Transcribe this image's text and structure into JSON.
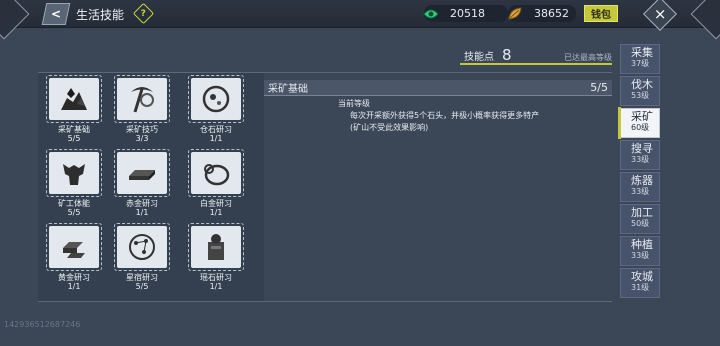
{
  "header": {
    "title": "生活技能",
    "back_label": "<",
    "help_label": "?",
    "currency_1": "20518",
    "currency_2": "38652",
    "wallet_label": "钱包",
    "close_label": "×"
  },
  "skill_points": {
    "label": "技能点",
    "value": "8",
    "max_text": "已达最高等级"
  },
  "skills": [
    {
      "name": "采矿基础",
      "level": "5/5",
      "icon": "ore-icon"
    },
    {
      "name": "采矿技巧",
      "level": "3/3",
      "icon": "pickaxe-icon"
    },
    {
      "name": "仓石研习",
      "level": "1/1",
      "icon": "stone-disc-icon"
    },
    {
      "name": "矿工体能",
      "level": "5/5",
      "icon": "muscle-icon"
    },
    {
      "name": "赤金研习",
      "level": "1/1",
      "icon": "ingot-bar-icon"
    },
    {
      "name": "白金研习",
      "level": "1/1",
      "icon": "ring-icon"
    },
    {
      "name": "黄金研习",
      "level": "1/1",
      "icon": "gold-bars-icon"
    },
    {
      "name": "星宿研习",
      "level": "5/5",
      "icon": "constellation-icon"
    },
    {
      "name": "瑶石研习",
      "level": "1/1",
      "icon": "jade-stone-icon"
    }
  ],
  "detail": {
    "title": "采矿基础",
    "level": "5/5",
    "current_level_label": "当前等级",
    "description": "每次开采额外获得5个石头，并极小概率获得更多特产(矿山不受此效果影响)"
  },
  "tabs": [
    {
      "label": "采集",
      "sub": "37级",
      "active": false
    },
    {
      "label": "伐木",
      "sub": "53级",
      "active": false
    },
    {
      "label": "采矿",
      "sub": "60级",
      "active": true
    },
    {
      "label": "搜寻",
      "sub": "33级",
      "active": false
    },
    {
      "label": "炼器",
      "sub": "33级",
      "active": false
    },
    {
      "label": "加工",
      "sub": "50级",
      "active": false
    },
    {
      "label": "种植",
      "sub": "33级",
      "active": false
    },
    {
      "label": "攻城",
      "sub": "31级",
      "active": false
    }
  ],
  "uid": "142936512687246",
  "colors": {
    "accent": "#c5c83a",
    "background": "#3b4657",
    "currency_green": "#2fd07a",
    "currency_gold": "#d9a441"
  }
}
